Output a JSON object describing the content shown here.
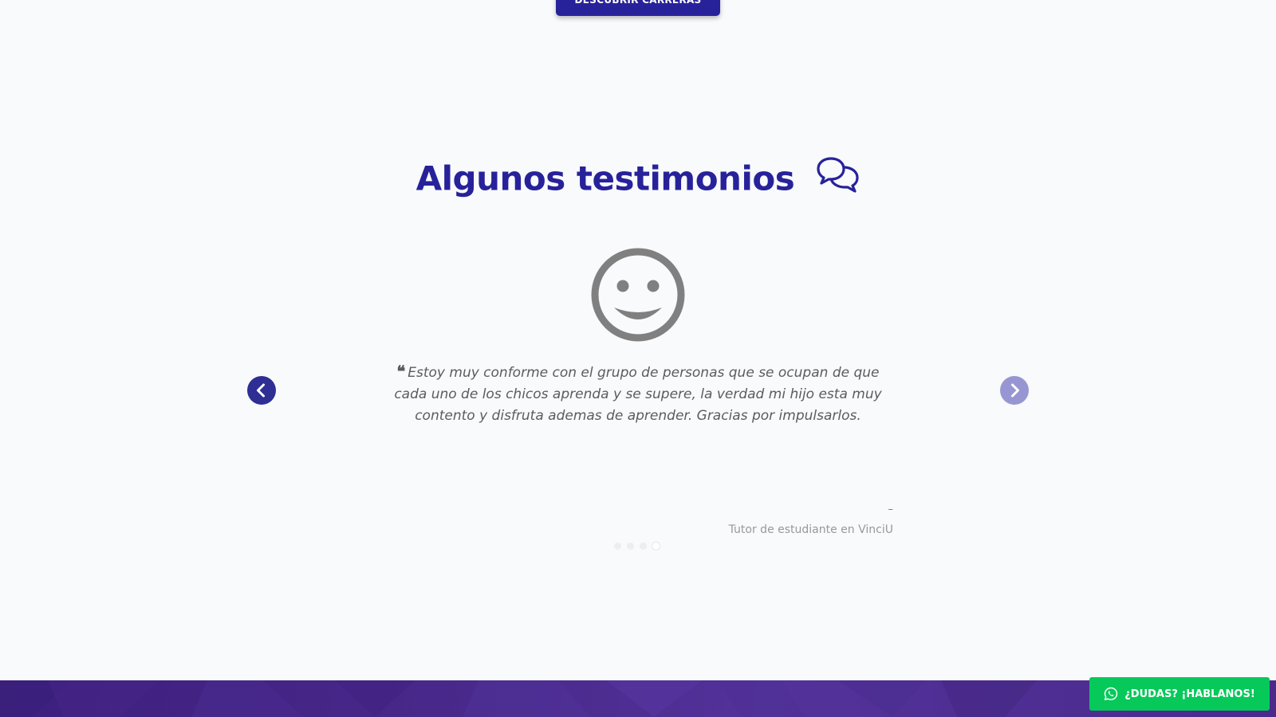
{
  "top_cta": {
    "label": "DESCUBRIR CARRERAS"
  },
  "testimonials": {
    "title": "Algunos testimonios",
    "title_icon": "chat-bubbles-icon",
    "avatar_icon": "smiley-face-icon",
    "quote": "Estoy muy conforme con el grupo de personas que se ocupan de que cada uno de los chicos aprenda y se supere, la verdad mi hijo esta muy contento y disfruta ademas de aprender. Gracias por impulsarlos.",
    "quote_mark": "❝",
    "author_name": "–",
    "author_role": "Tutor de estudiante en VinciU",
    "prev_icon": "chevron-left-icon",
    "next_icon": "chevron-right-icon",
    "pagination": {
      "total": 4,
      "active": 4
    }
  },
  "whatsapp": {
    "label": "¿DUDAS? ¡HABLANOS!",
    "icon": "whatsapp-icon"
  },
  "colors": {
    "brand": "#27229a",
    "background": "#f8fafb",
    "whatsapp": "#06c95a",
    "footer": "#4a2a8c",
    "text_muted": "#5b5b62"
  }
}
